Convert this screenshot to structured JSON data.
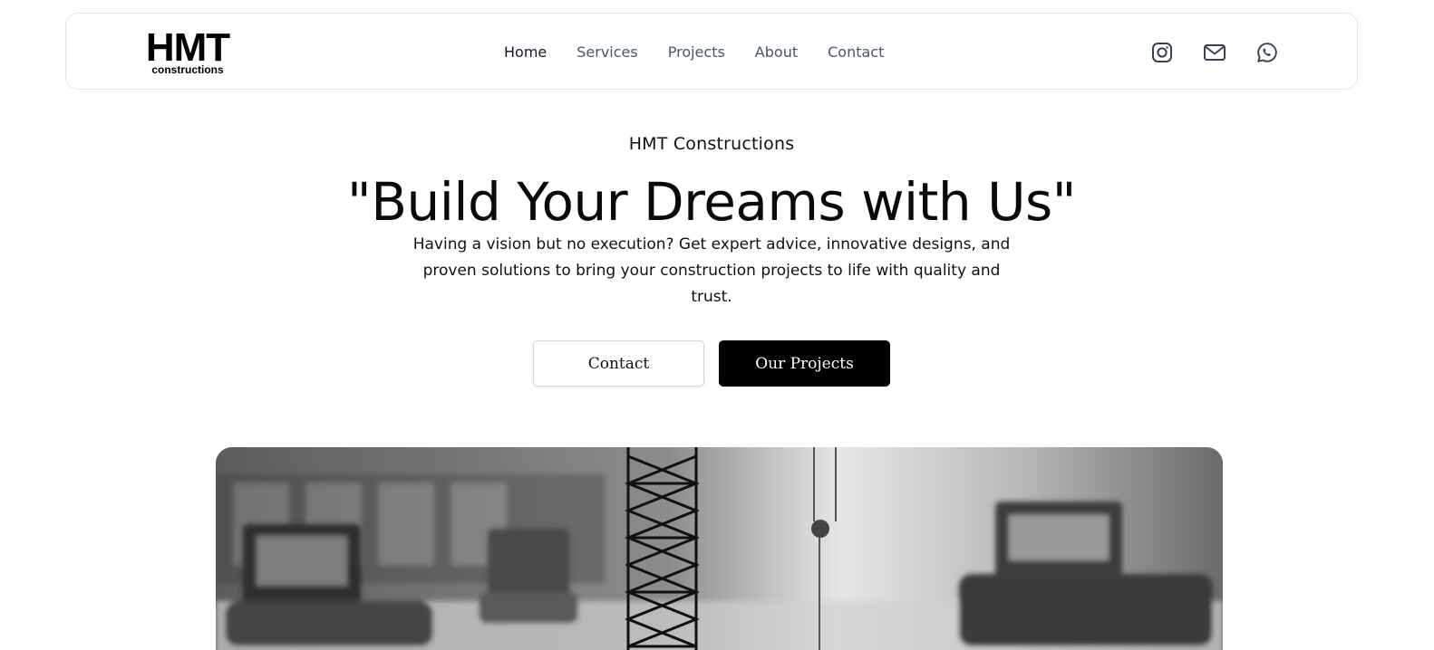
{
  "brand": {
    "logo_mark": "HMT",
    "logo_sub": "constructions"
  },
  "nav": {
    "items": [
      {
        "label": "Home",
        "active": true
      },
      {
        "label": "Services",
        "active": false
      },
      {
        "label": "Projects",
        "active": false
      },
      {
        "label": "About",
        "active": false
      },
      {
        "label": "Contact",
        "active": false
      }
    ]
  },
  "social": [
    "instagram-icon",
    "mail-icon",
    "whatsapp-icon"
  ],
  "hero": {
    "kicker": "HMT Constructions",
    "title": "\"Build Your Dreams with Us\"",
    "description": "Having a vision but no execution? Get expert advice, innovative designs, and proven solutions to bring your construction projects to life with quality and trust.",
    "primary_button": "Our Projects",
    "secondary_button": "Contact"
  },
  "colors": {
    "accent": "#000000",
    "nav_text": "#4b5563",
    "border": "#e4e4e7"
  }
}
